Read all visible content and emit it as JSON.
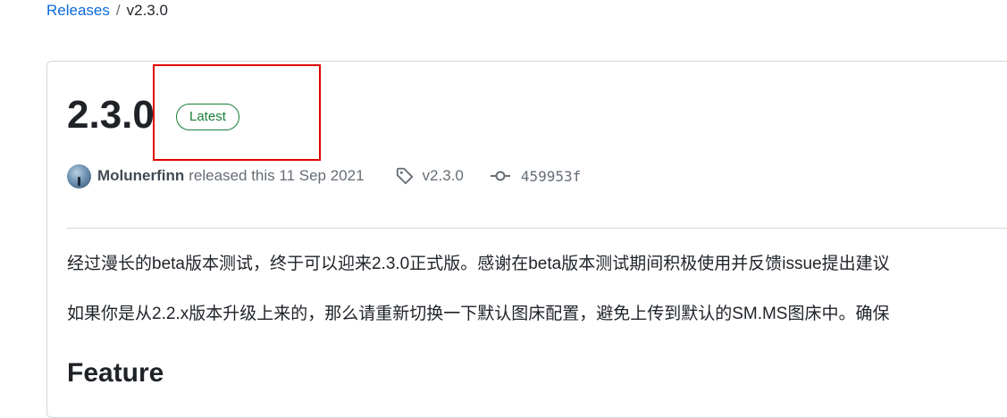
{
  "breadcrumb": {
    "releases_link": "Releases",
    "separator": "/",
    "current": "v2.3.0"
  },
  "release": {
    "title": "2.3.0",
    "badge": "Latest",
    "author": "Molunerfinn",
    "released_text": "released this 11 Sep 2021",
    "tag": "v2.3.0",
    "commit": "459953f"
  },
  "body": {
    "paragraph1": "经过漫长的beta版本测试，终于可以迎来2.3.0正式版。感谢在beta版本测试期间积极使用并反馈issue提出建议",
    "paragraph2": "如果你是从2.2.x版本升级上来的，那么请重新切换一下默认图床配置，避免上传到默认的SM.MS图床中。确保",
    "heading": "Feature"
  },
  "icons": {
    "tag": "tag-icon",
    "commit": "git-commit-icon",
    "avatar": "user-avatar"
  },
  "colors": {
    "link": "#0969da",
    "badge_green": "#1a7f37",
    "highlight_red": "#e00000",
    "muted": "#656d76"
  }
}
